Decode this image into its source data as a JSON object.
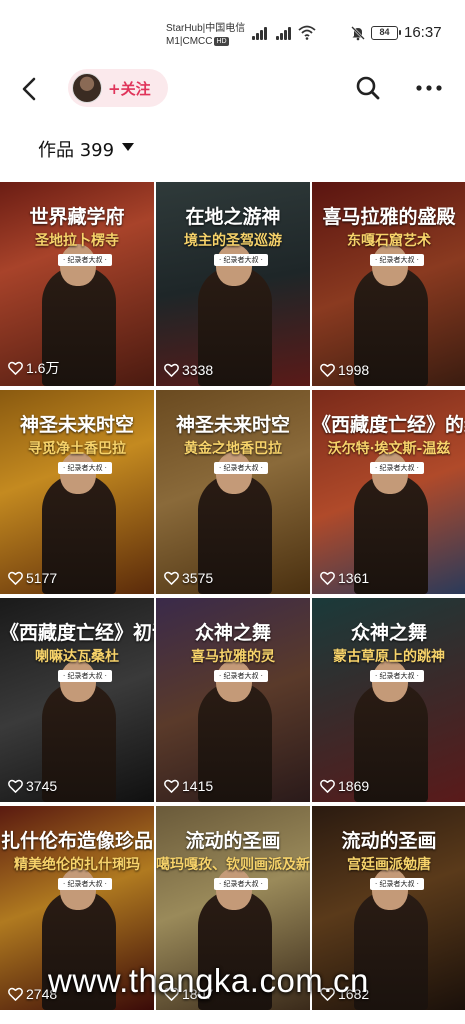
{
  "status_bar": {
    "carrier_line1": "StarHub|中国电信",
    "carrier_line2": "M1|CMCC",
    "hd_badge": "HD",
    "battery": "84",
    "time": "16:37"
  },
  "nav": {
    "back_icon": "chevron-left-icon",
    "follow_label": "+关注",
    "search_icon": "search-icon",
    "more_icon": "more-horizontal-icon"
  },
  "works": {
    "label": "作品 399"
  },
  "cards": [
    {
      "title": "世界藏学府",
      "subtitle": "圣地拉卜楞寺",
      "tag": "· 纪录者大叔 ·",
      "likes": "1.6万",
      "bg": "linear-gradient(160deg,#6b1d14 0%,#a8432a 35%,#4a1a10 100%)"
    },
    {
      "title": "在地之游神",
      "subtitle": "境主的圣驾巡游",
      "tag": "· 纪录者大叔 ·",
      "likes": "3338",
      "bg": "linear-gradient(170deg,#2f3a3a 0%,#1e2628 50%,#5a1a18 100%)"
    },
    {
      "title": "喜马拉雅的盛殿",
      "subtitle": "东嘎石窟艺术",
      "tag": "· 纪录者大叔 ·",
      "likes": "1998",
      "bg": "linear-gradient(160deg,#5a1410 0%,#8a3a20 50%,#3a1c10 100%)"
    },
    {
      "title": "神圣未来时空",
      "subtitle": "寻觅净土香巴拉",
      "tag": "· 纪录者大叔 ·",
      "likes": "5177",
      "bg": "linear-gradient(160deg,#8a5a10 0%,#c48a20 40%,#5a2a0a 100%)"
    },
    {
      "title": "神圣未来时空",
      "subtitle": "黄金之地香巴拉",
      "tag": "· 纪录者大叔 ·",
      "likes": "3575",
      "bg": "linear-gradient(160deg,#6a4a20 0%,#8a6a3a 45%,#4a3010 100%)"
    },
    {
      "title": "《西藏度亡经》的编辑与出版",
      "subtitle": "沃尔特·埃文斯-温兹",
      "tag": "· 纪录者大叔 ·",
      "likes": "1361",
      "bg": "linear-gradient(160deg,#7a2a1a 0%,#b04a2a 50%,#2a3a5a 100%)"
    },
    {
      "title": "《西藏度亡经》初译者",
      "subtitle": "喇嘛达瓦桑杜",
      "tag": "· 纪录者大叔 ·",
      "likes": "3745",
      "bg": "linear-gradient(160deg,#1a1a1a 0%,#3a3a3a 50%,#101010 100%)"
    },
    {
      "title": "众神之舞",
      "subtitle": "喜马拉雅的灵",
      "tag": "· 纪录者大叔 ·",
      "likes": "1415",
      "bg": "linear-gradient(160deg,#3a2a4a 0%,#5a3a2a 50%,#2a1a1a 100%)"
    },
    {
      "title": "众神之舞",
      "subtitle": "蒙古草原上的跳神",
      "tag": "· 纪录者大叔 ·",
      "likes": "1869",
      "bg": "linear-gradient(160deg,#1a3a3a 0%,#3a2a2a 50%,#5a1a1a 100%)"
    },
    {
      "title": "扎什伦布造像珍品",
      "subtitle": "精美绝伦的扎什琍玛",
      "tag": "· 纪录者大叔 ·",
      "likes": "2748",
      "bg": "linear-gradient(160deg,#5a1a10 0%,#b07a20 45%,#3a0a08 100%)"
    },
    {
      "title": "流动的圣画",
      "subtitle": "噶玛嘎孜、钦则画派及新勉唐卡艺术品",
      "tag": "· 纪录者大叔 ·",
      "likes": "1807",
      "bg": "linear-gradient(160deg,#6a5a3a 0%,#9a8a5a 45%,#3a2a1a 100%)"
    },
    {
      "title": "流动的圣画",
      "subtitle": "宫廷画派勉唐",
      "tag": "· 纪录者大叔 ·",
      "likes": "1682",
      "bg": "linear-gradient(160deg,#2a1a10 0%,#5a3a1a 45%,#1a100a 100%)"
    }
  ],
  "watermark": "www.thangka.com.cn"
}
